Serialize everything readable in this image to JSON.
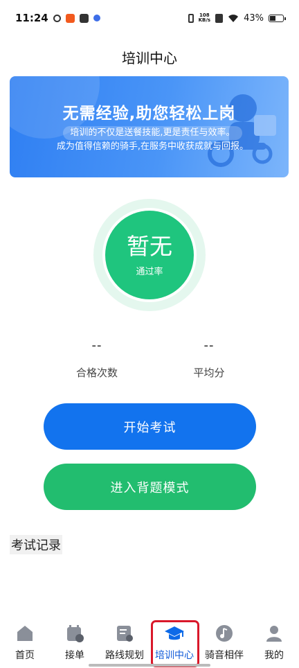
{
  "status_bar": {
    "time": "11:24",
    "net_speed_value": "108",
    "net_speed_unit": "KB/s",
    "battery": "43%"
  },
  "header": {
    "title": "培训中心"
  },
  "banner": {
    "title": "无需经验,助您轻松上岗",
    "subtitle_line1": "培训的不仅是送餐技能,更是责任与效率。",
    "subtitle_line2": "成为值得信赖的骑手,在服务中收获成就与回报。",
    "image_icon": "delivery-rider-illustration"
  },
  "pass_rate": {
    "value": "暂无",
    "label": "通过率"
  },
  "stats": {
    "pass_count": {
      "value": "--",
      "label": "合格次数"
    },
    "average_score": {
      "value": "--",
      "label": "平均分"
    }
  },
  "buttons": {
    "start_exam": "开始考试",
    "study_mode": "进入背题模式"
  },
  "records": {
    "title": "考试记录"
  },
  "bottom_nav": {
    "items": [
      {
        "label": "首页",
        "icon": "home-icon"
      },
      {
        "label": "接单",
        "icon": "order-calendar-icon"
      },
      {
        "label": "路线规划",
        "icon": "route-plan-icon"
      },
      {
        "label": "培训中心",
        "icon": "graduation-cap-icon",
        "active": true
      },
      {
        "label": "骑音相伴",
        "icon": "music-note-icon"
      },
      {
        "label": "我的",
        "icon": "user-icon"
      }
    ]
  },
  "colors": {
    "primary_blue": "#1273ee",
    "success_green": "#22bd6f",
    "active_nav": "#0d58d8",
    "highlight_border": "#d9182a"
  }
}
